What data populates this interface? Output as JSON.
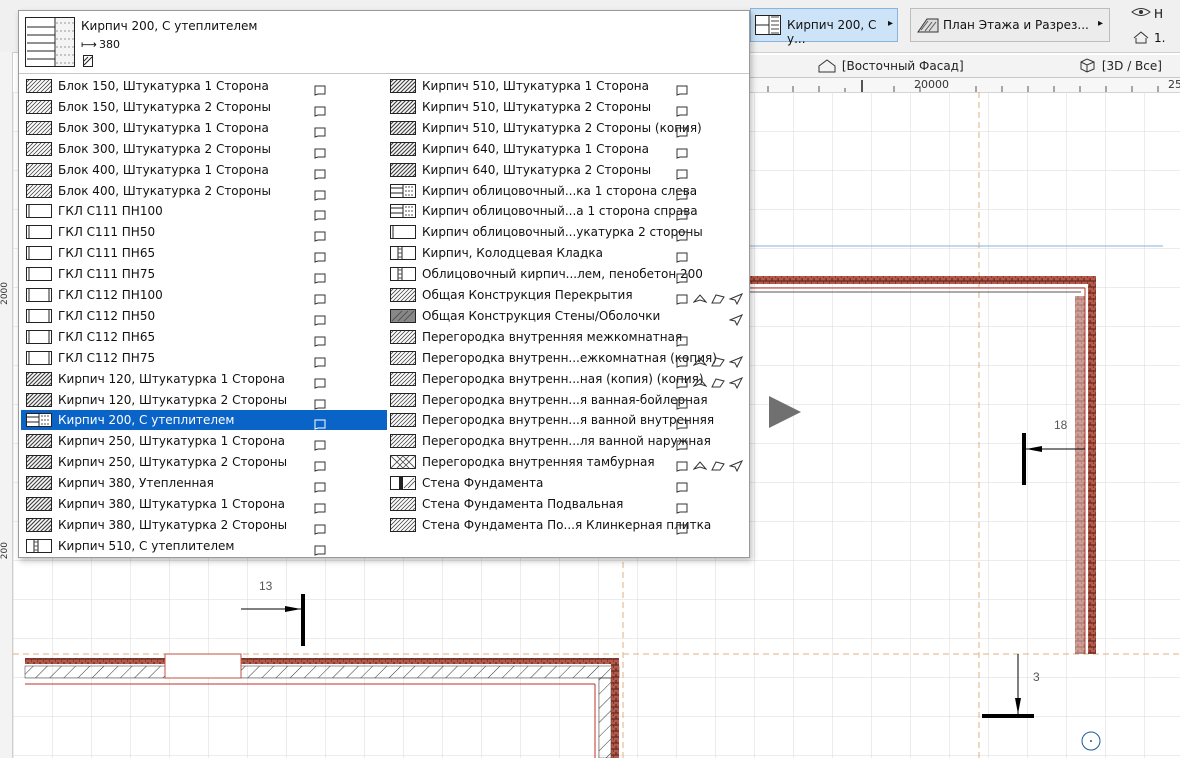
{
  "toolbar": {
    "wall_button_label": "Кирпич 200, С у...",
    "wall_button_arrow": "▸",
    "plan_button_label": "План Этажа и Разрез...",
    "plan_button_arrow": "▸",
    "right_label_1": "Н",
    "right_label_2": "1."
  },
  "view_tabs": [
    {
      "label": "[Восточный Фасад]",
      "icon": "house-elevation-icon"
    },
    {
      "label": "[3D / Все]",
      "icon": "cube-3d-icon"
    }
  ],
  "ruler": {
    "top_label_1": "20000",
    "top_label_2": "25",
    "left_label_1": "2000",
    "left_label_2": "200"
  },
  "popup": {
    "header": {
      "title": "Кирпич 200, С утеплителем",
      "width": "380"
    },
    "left_items": [
      {
        "name": "Блок 150, Штукатурка 1 Сторона",
        "swatch": "hatch",
        "flags": [
          "plan"
        ]
      },
      {
        "name": "Блок 150, Штукатурка 2 Стороны",
        "swatch": "hatch",
        "flags": [
          "plan"
        ]
      },
      {
        "name": "Блок 300, Штукатурка 1 Сторона",
        "swatch": "hatch",
        "flags": [
          "plan"
        ]
      },
      {
        "name": "Блок 300, Штукатурка 2 Стороны",
        "swatch": "hatch",
        "flags": [
          "plan"
        ]
      },
      {
        "name": "Блок 400, Штукатурка 1 Сторона",
        "swatch": "hatch",
        "flags": [
          "plan"
        ]
      },
      {
        "name": "Блок 400, Штукатурка 2 Стороны",
        "swatch": "hatch",
        "flags": [
          "plan"
        ]
      },
      {
        "name": "ГКЛ С111 ПН100",
        "swatch": "gkl",
        "flags": [
          "plan"
        ]
      },
      {
        "name": "ГКЛ С111 ПН50",
        "swatch": "gkl",
        "flags": [
          "plan"
        ]
      },
      {
        "name": "ГКЛ С111 ПН65",
        "swatch": "gkl",
        "flags": [
          "plan"
        ]
      },
      {
        "name": "ГКЛ С111 ПН75",
        "swatch": "gkl",
        "flags": [
          "plan"
        ]
      },
      {
        "name": "ГКЛ С112 ПН100",
        "swatch": "gkl2",
        "flags": [
          "plan"
        ]
      },
      {
        "name": "ГКЛ С112 ПН50",
        "swatch": "gkl2",
        "flags": [
          "plan"
        ]
      },
      {
        "name": "ГКЛ С112 ПН65",
        "swatch": "gkl2",
        "flags": [
          "plan"
        ]
      },
      {
        "name": "ГКЛ С112 ПН75",
        "swatch": "gkl2",
        "flags": [
          "plan"
        ]
      },
      {
        "name": "Кирпич 120, Штукатурка 1 Сторона",
        "swatch": "brick",
        "flags": [
          "plan"
        ]
      },
      {
        "name": "Кирпич 120, Штукатурка 2 Стороны",
        "swatch": "brick",
        "flags": [
          "plan"
        ]
      },
      {
        "name": "Кирпич 200, С утеплителем",
        "swatch": "insul",
        "flags": [
          "plan"
        ],
        "selected": true
      },
      {
        "name": "Кирпич 250, Штукатурка 1 Сторона",
        "swatch": "brick",
        "flags": [
          "plan"
        ]
      },
      {
        "name": "Кирпич 250, Штукатурка 2 Стороны",
        "swatch": "brick",
        "flags": [
          "plan"
        ]
      },
      {
        "name": "Кирпич 380, Утепленная",
        "swatch": "brick",
        "flags": [
          "plan"
        ]
      },
      {
        "name": "Кирпич 380, Штукатурка 1 Сторона",
        "swatch": "brick",
        "flags": [
          "plan"
        ]
      },
      {
        "name": "Кирпич 380, Штукатурка 2 Стороны",
        "swatch": "brick",
        "flags": [
          "plan"
        ]
      },
      {
        "name": "Кирпич 510, С утеплителем",
        "swatch": "insul2",
        "flags": [
          "plan"
        ]
      }
    ],
    "right_items": [
      {
        "name": "Кирпич 510, Штукатурка 1 Сторона",
        "swatch": "brick",
        "flags": [
          "plan"
        ]
      },
      {
        "name": "Кирпич 510, Штукатурка 2 Стороны",
        "swatch": "brick",
        "flags": [
          "plan"
        ]
      },
      {
        "name": "Кирпич 510, Штукатурка 2 Стороны (копия)",
        "swatch": "brick",
        "flags": [
          "plan"
        ]
      },
      {
        "name": "Кирпич 640, Штукатурка 1 Сторона",
        "swatch": "brick",
        "flags": [
          "plan"
        ]
      },
      {
        "name": "Кирпич 640, Штукатурка 2 Стороны",
        "swatch": "brick",
        "flags": [
          "plan"
        ]
      },
      {
        "name": "Кирпич облицовочный...ка 1 сторона слева",
        "swatch": "insul",
        "flags": [
          "plan"
        ]
      },
      {
        "name": "Кирпич облицовочный...а 1 сторона справа",
        "swatch": "insul",
        "flags": [
          "plan"
        ]
      },
      {
        "name": "Кирпич облицовочный...укатурка 2 стороны",
        "swatch": "gkl",
        "flags": [
          "plan"
        ]
      },
      {
        "name": "Кирпич, Колодцевая Кладка",
        "swatch": "insul2",
        "flags": [
          "plan"
        ]
      },
      {
        "name": "Облицовочный кирпич...лем, пенобетон 200",
        "swatch": "insul2",
        "flags": [
          "plan"
        ]
      },
      {
        "name": "Общая Конструкция Перекрытия",
        "swatch": "hatch",
        "flags": [
          "plan",
          "roof",
          "shell",
          "send"
        ]
      },
      {
        "name": "Общая Конструкция Стены/Оболочки",
        "swatch": "grey",
        "flags": [
          "send"
        ]
      },
      {
        "name": "Перегородка внутренняя межкомнатная",
        "swatch": "hatch",
        "flags": [
          "plan"
        ]
      },
      {
        "name": "Перегородка внутренн...ежкомнатная (копия)",
        "swatch": "hatch",
        "flags": [
          "plan",
          "roof",
          "shell",
          "send"
        ]
      },
      {
        "name": "Перегородка внутренн...ная (копия) (копия)",
        "swatch": "hatch",
        "flags": [
          "plan",
          "roof",
          "shell",
          "send"
        ]
      },
      {
        "name": "Перегородка внутренн...я ванная-бойлерная",
        "swatch": "hatch",
        "flags": [
          "plan"
        ]
      },
      {
        "name": "Перегородка внутренн...я ванной внутренняя",
        "swatch": "hatch",
        "flags": [
          "plan"
        ]
      },
      {
        "name": "Перегородка внутренн...ля ванной наружная",
        "swatch": "hatch",
        "flags": [
          "plan"
        ]
      },
      {
        "name": "Перегородка внутренняя тамбурная",
        "swatch": "cross",
        "flags": [
          "plan",
          "roof",
          "shell",
          "send"
        ]
      },
      {
        "name": "Стена Фундамента",
        "swatch": "found",
        "flags": [
          "plan"
        ]
      },
      {
        "name": "Стена Фундамента Подвальная",
        "swatch": "hatch",
        "flags": [
          "plan"
        ]
      },
      {
        "name": "Стена Фундамента По...я Клинкерная плитка",
        "swatch": "hatch",
        "flags": [
          "plan"
        ]
      }
    ]
  },
  "markers": [
    {
      "label": "13",
      "kind": "elevation-marker-right"
    },
    {
      "label": "18",
      "kind": "elevation-marker-left"
    },
    {
      "label": "3",
      "kind": "elevation-marker-down"
    }
  ],
  "colors": {
    "selection": "#0a63c7",
    "grid": "#d9d9d9",
    "axis": "#e0b080",
    "wall_brick": "#8a3a2a",
    "wall_red_line": "#c0302a"
  }
}
